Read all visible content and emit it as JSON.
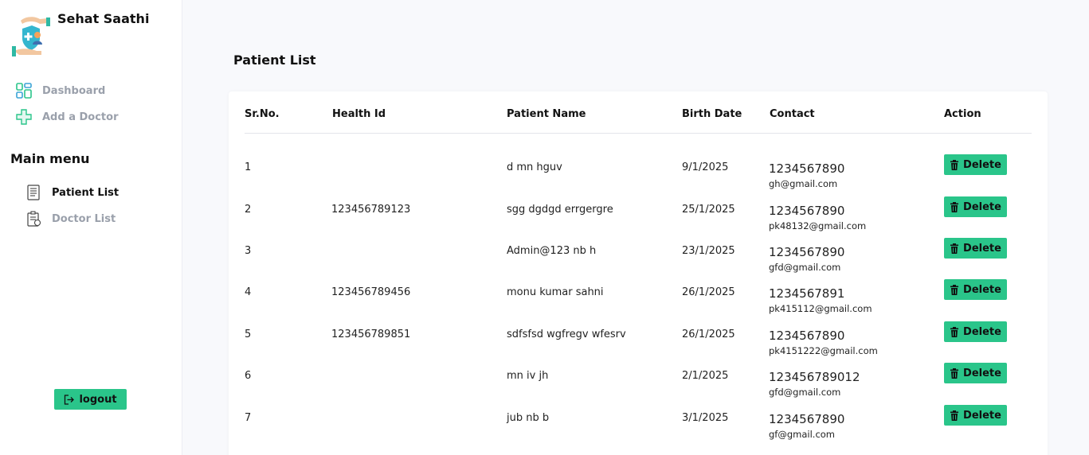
{
  "brand": {
    "name": "Sehat Saathi",
    "logo_icon": "shield-hands-logo"
  },
  "nav": [
    {
      "label": "Dashboard",
      "icon": "grid-icon"
    },
    {
      "label": "Add a Doctor",
      "icon": "plus-cross-icon"
    }
  ],
  "main_menu": {
    "heading": "Main menu",
    "items": [
      {
        "label": "Patient List",
        "icon": "document-list-icon",
        "active": true
      },
      {
        "label": "Doctor List",
        "icon": "clipboard-icon",
        "active": false
      }
    ]
  },
  "logout": {
    "label": "logout",
    "icon": "logout-icon"
  },
  "page": {
    "title": "Patient List"
  },
  "table": {
    "headers": {
      "sr": "Sr.No.",
      "health_id": "Health Id",
      "name": "Patient Name",
      "birth": "Birth Date",
      "contact": "Contact",
      "action": "Action"
    },
    "delete_label": "Delete",
    "rows": [
      {
        "sr": "1",
        "health_id": "",
        "name": "d mn hguv",
        "birth": "9/1/2025",
        "phone": "1234567890",
        "email": "gh@gmail.com"
      },
      {
        "sr": "2",
        "health_id": "123456789123",
        "name": "sgg dgdgd errgergre",
        "birth": "25/1/2025",
        "phone": "1234567890",
        "email": "pk48132@gmail.com"
      },
      {
        "sr": "3",
        "health_id": "",
        "name": "Admin@123 nb h",
        "birth": "23/1/2025",
        "phone": "1234567890",
        "email": "gfd@gmail.com"
      },
      {
        "sr": "4",
        "health_id": "123456789456",
        "name": "monu kumar sahni",
        "birth": "26/1/2025",
        "phone": "1234567891",
        "email": "pk415112@gmail.com"
      },
      {
        "sr": "5",
        "health_id": "123456789851",
        "name": "sdfsfsd wgfregv wfesrv",
        "birth": "26/1/2025",
        "phone": "1234567890",
        "email": "pk4151222@gmail.com"
      },
      {
        "sr": "6",
        "health_id": "",
        "name": "mn iv jh",
        "birth": "2/1/2025",
        "phone": "123456789012",
        "email": "gfd@gmail.com"
      },
      {
        "sr": "7",
        "health_id": "",
        "name": "jub nb b",
        "birth": "3/1/2025",
        "phone": "1234567890",
        "email": "gf@gmail.com"
      }
    ]
  },
  "colors": {
    "accent": "#2ac58a",
    "sidebar_bg": "#ffffff",
    "main_bg": "#f8f9fc",
    "muted_text": "#9aa0ab"
  }
}
